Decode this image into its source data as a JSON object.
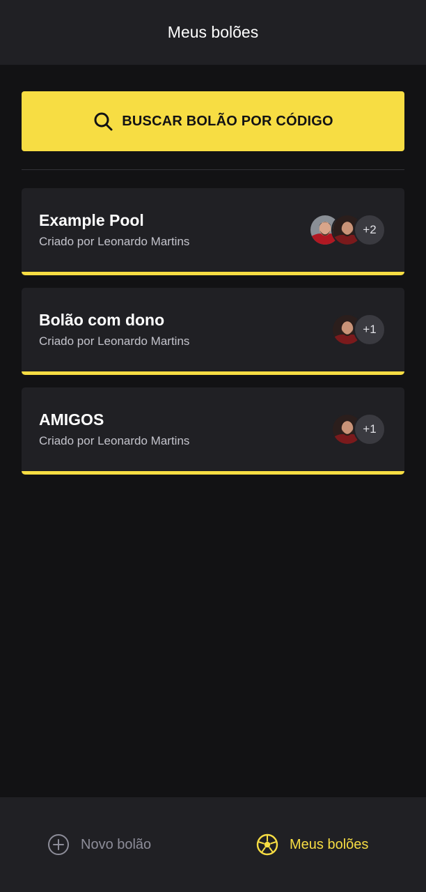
{
  "header": {
    "title": "Meus bolões"
  },
  "search": {
    "label": "BUSCAR BOLÃO POR CÓDIGO",
    "icon": "search-icon"
  },
  "pools": [
    {
      "title": "Example Pool",
      "owner": "Criado por Leonardo Martins",
      "extra_participants": "+2",
      "avatar_count": 2
    },
    {
      "title": "Bolão com dono",
      "owner": "Criado por Leonardo Martins",
      "extra_participants": "+1",
      "avatar_count": 1
    },
    {
      "title": "AMIGOS",
      "owner": "Criado por Leonardo Martins",
      "extra_participants": "+1",
      "avatar_count": 1
    }
  ],
  "bottom_nav": {
    "new_pool": {
      "label": "Novo bolão",
      "icon": "plus-circle-icon",
      "active": false
    },
    "my_pools": {
      "label": "Meus bolões",
      "icon": "soccer-ball-icon",
      "active": true
    }
  },
  "colors": {
    "accent": "#f7dd43",
    "background": "#121214",
    "surface": "#202024",
    "text_muted": "#8d8d99"
  }
}
